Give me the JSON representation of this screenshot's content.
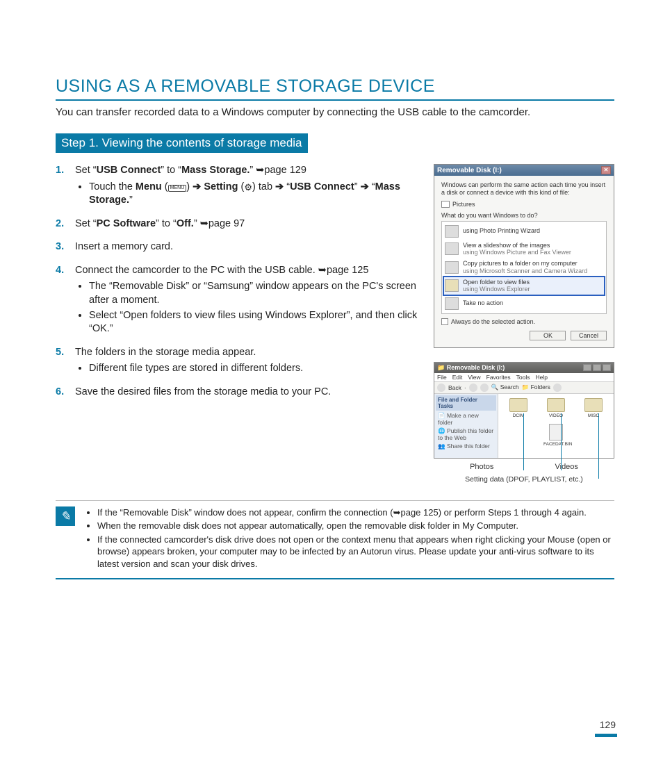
{
  "title": "USING AS A REMOVABLE STORAGE DEVICE",
  "intro": "You can transfer recorded data to a Windows computer by connecting the USB cable to the camcorder.",
  "step_header": "Step 1. Viewing the contents of storage media",
  "steps": {
    "s1": {
      "num": "1.",
      "pre": "Set “",
      "usb_connect": "USB Connect",
      "mid1": "” to “",
      "mass_storage": "Mass Storage.",
      "post1": "” ",
      "page_ref": "➥page 129",
      "bullet_pre": "Touch the ",
      "menu": "Menu",
      "arrow": " ➔ ",
      "setting": "Setting",
      "tab": " tab ",
      "usb_connect2": "USB Connect",
      "mass_storage2": "Mass Storage."
    },
    "s2": {
      "num": "2.",
      "pre": "Set “",
      "pc_software": "PC Software",
      "mid": "” to “",
      "off": "Off.",
      "post": "” ",
      "page_ref": "➥page 97"
    },
    "s3": {
      "num": "3.",
      "text": "Insert a memory card."
    },
    "s4": {
      "num": "4.",
      "text": "Connect the camcorder to the PC with the USB cable.",
      "page_ref": "➥page 125",
      "b1": "The “Removable Disk” or “Samsung” window appears on the PC's screen after a moment.",
      "b2": "Select “Open folders to view files using Windows Explorer”, and then click “OK.”"
    },
    "s5": {
      "num": "5.",
      "text": "The folders in the storage media appear.",
      "b1": "Different file types are stored in different folders."
    },
    "s6": {
      "num": "6.",
      "text": "Save the desired files from the storage media to your PC."
    }
  },
  "dialog": {
    "title": "Removable Disk (I:)",
    "desc": "Windows can perform the same action each time you insert a disk or connect a device with this kind of file:",
    "pictures": "Pictures",
    "prompt": "What do you want Windows to do?",
    "opt1_t": "using Photo Printing Wizard",
    "opt2_t": "View a slideshow of the images",
    "opt2_s": "using Windows Picture and Fax Viewer",
    "opt3_t": "Copy pictures to a folder on my computer",
    "opt3_s": "using Microsoft Scanner and Camera Wizard",
    "opt4_t": "Open folder to view files",
    "opt4_s": "using Windows Explorer",
    "opt5_t": "Take no action",
    "checkbox": "Always do the selected action.",
    "ok": "OK",
    "cancel": "Cancel"
  },
  "explorer": {
    "title": "Removable Disk (I:)",
    "menu": {
      "file": "File",
      "edit": "Edit",
      "view": "View",
      "fav": "Favorites",
      "tools": "Tools",
      "help": "Help"
    },
    "toolbar": {
      "back": "Back",
      "search": "Search",
      "folders": "Folders"
    },
    "side_title": "File and Folder Tasks",
    "side1": "Make a new folder",
    "side2": "Publish this folder to the Web",
    "side3": "Share this folder",
    "f1": "DCIM",
    "f2": "VIDEO",
    "f3": "MISC",
    "f4": "FACEDAT.BIN"
  },
  "callouts": {
    "photos": "Photos",
    "videos": "Videos",
    "setting": "Setting data (DPOF, PLAYLIST, etc.)"
  },
  "notes": {
    "n1": "If the “Removable Disk” window does not appear, confirm the connection (➥page 125) or perform Steps 1 through 4 again.",
    "n2": "When the removable disk does not appear automatically, open the removable disk folder in My Computer.",
    "n3": "If the connected camcorder's disk drive does not open or the context menu that appears when right clicking your Mouse (open or browse) appears broken, your computer may to be infected by an Autorun virus. Please update your anti-virus software to its latest version and scan your disk drives."
  },
  "page_number": "129"
}
